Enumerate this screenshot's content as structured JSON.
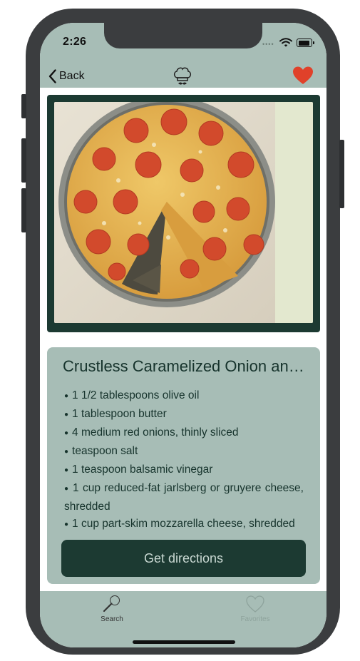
{
  "status": {
    "time": "2:26",
    "signal_icon": "signal-dots-icon",
    "wifi_icon": "wifi-icon",
    "battery_icon": "battery-icon"
  },
  "navbar": {
    "back_label": "Back",
    "back_icon": "chevron-left-icon",
    "logo_icon": "chef-hat-icon",
    "favorite_icon": "heart-icon"
  },
  "recipe": {
    "photo": "frittata-photo",
    "title": "Crustless Caramelized Onion and Tomato Frittata",
    "ingredients": [
      "1 1/2 tablespoons olive oil",
      "1 tablespoon butter",
      "4 medium red onions, thinly sliced",
      "teaspoon salt",
      "1 teaspoon balsamic vinegar",
      "1 cup reduced-fat jarlsberg or gruyere cheese, shredded",
      "1 cup part-skim mozzarella cheese, shredded"
    ],
    "directions_label": "Get directions"
  },
  "tabs": [
    {
      "label": "Search",
      "icon": "search-icon",
      "active": true
    },
    {
      "label": "Favorites",
      "icon": "heart-outline-icon",
      "active": false
    }
  ],
  "colors": {
    "bar_bg": "#a7bdb6",
    "dark_green": "#1c3a32",
    "heart_red": "#e0412a",
    "button_text": "#c9d8d2"
  }
}
